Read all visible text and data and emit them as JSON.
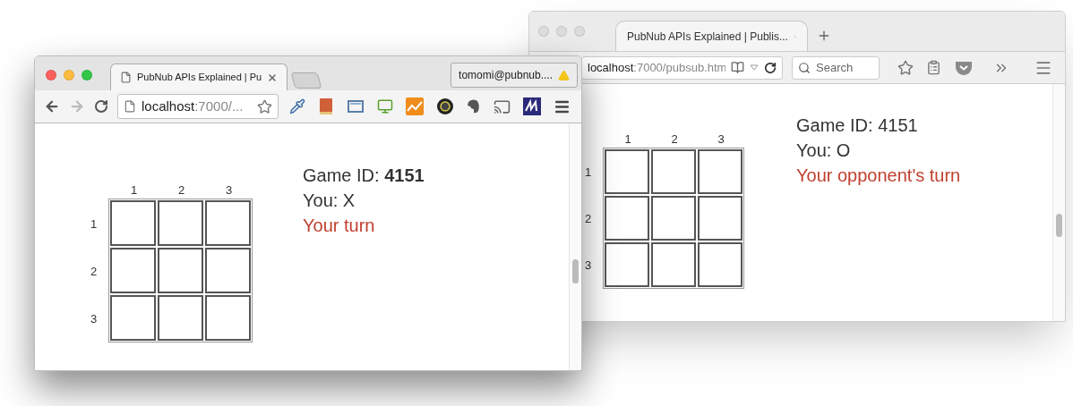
{
  "windows": [
    {
      "kind": "firefox",
      "focused": false,
      "tab": {
        "title": "PubNub APIs Explained | Publis..."
      },
      "address": {
        "host": "localhost",
        "rest": ":7000/pubsub.htm"
      },
      "search": {
        "placeholder": "Search"
      },
      "game": {
        "column_labels": [
          "1",
          "2",
          "3"
        ],
        "row_labels": [
          "1",
          "2",
          "3"
        ],
        "game_id": "Game ID: 4151",
        "player": "You: O",
        "turn": "Your opponent's turn"
      }
    },
    {
      "kind": "chrome",
      "focused": true,
      "tab": {
        "title": "PubNub APIs Explained | Pu"
      },
      "profile": "tomomi@pubnub....",
      "address": {
        "host": "localhost",
        "rest": ":7000/..."
      },
      "game": {
        "column_labels": [
          "1",
          "2",
          "3"
        ],
        "row_labels": [
          "1",
          "2",
          "3"
        ],
        "game_id": "Game ID: **4151**",
        "player": "You: X",
        "turn": "Your turn"
      }
    }
  ]
}
